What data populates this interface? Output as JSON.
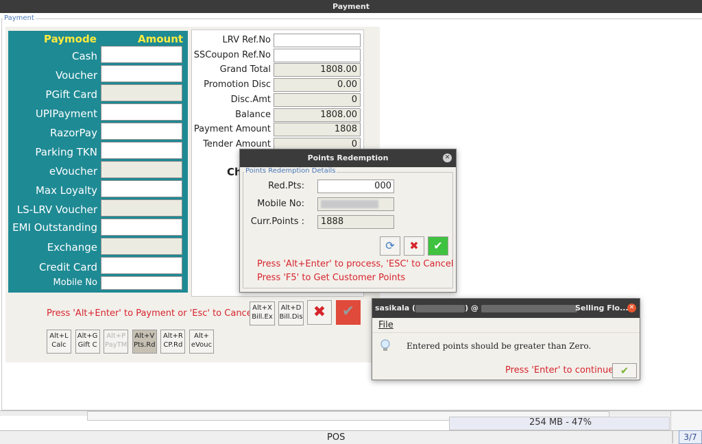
{
  "window": {
    "title": "Payment"
  },
  "payment": {
    "group_label": "Payment",
    "headers": {
      "paymode": "Paymode",
      "amount": "Amount"
    },
    "modes": [
      "Cash",
      "Voucher",
      "PGift Card",
      "UPIPayment",
      "RazorPay",
      "Parking TKN",
      "eVoucher",
      "Max Loyalty",
      "LS-LRV Voucher",
      "EMI Outstanding",
      "Exchange",
      "Credit Card",
      "Mobile No"
    ],
    "summary": [
      {
        "label": "LRV Ref.No",
        "value": ""
      },
      {
        "label": "SSCoupon Ref.No",
        "value": ""
      },
      {
        "label": "Grand Total",
        "value": "1808.00"
      },
      {
        "label": "Promotion Disc",
        "value": "0.00"
      },
      {
        "label": "Disc.Amt",
        "value": "0"
      },
      {
        "label": "Balance",
        "value": "1808.00"
      },
      {
        "label": "Payment Amount",
        "value": "1808"
      },
      {
        "label": "Tender Amount",
        "value": "0"
      }
    ],
    "change_partial": "Ch",
    "hint": "Press 'Alt+Enter' to Payment or 'Esc' to Cancel",
    "bill_buttons": [
      {
        "line1": "Alt+X",
        "line2": "Bill.Ex"
      },
      {
        "line1": "Alt+D",
        "line2": "Bill.Dis"
      }
    ],
    "shortcut_buttons": [
      {
        "line1": "Alt+L",
        "line2": "Calc"
      },
      {
        "line1": "Alt+G",
        "line2": "Gift C"
      },
      {
        "line1": "Alt+P",
        "line2": "PayTM"
      },
      {
        "line1": "Alt+V",
        "line2": "Pts.Rd"
      },
      {
        "line1": "Alt+R",
        "line2": "CP.Rd"
      },
      {
        "line1": "Alt+",
        "line2": "eVouc"
      }
    ]
  },
  "points_dialog": {
    "title": "Points Redemption",
    "group_label": "Points Redemption Details",
    "red_pts_label": "Red.Pts:",
    "red_pts_value": "000",
    "mobile_label": "Mobile No:",
    "curr_points_label": "Curr.Points :",
    "curr_points_value": "1888",
    "hint1": "Press 'Alt+Enter' to process, 'ESC' to Cancel",
    "hint2": "Press 'F5' to Get Customer Points"
  },
  "alert_dialog": {
    "title_user": "sasikala (",
    "title_mid": ") @",
    "title_right": "Selling Flo...",
    "menu_file": "File",
    "message": "Entered points should be greater than Zero.",
    "continue_hint": "Press 'Enter' to continue"
  },
  "statusbar": {
    "memory": "254 MB - 47%",
    "app": "POS",
    "page": "3/7"
  },
  "colors": {
    "teal": "#1e8a94",
    "header_yellow": "#ffec3d",
    "hint_red": "#d6242c",
    "title_dark": "#3b3b3b"
  }
}
